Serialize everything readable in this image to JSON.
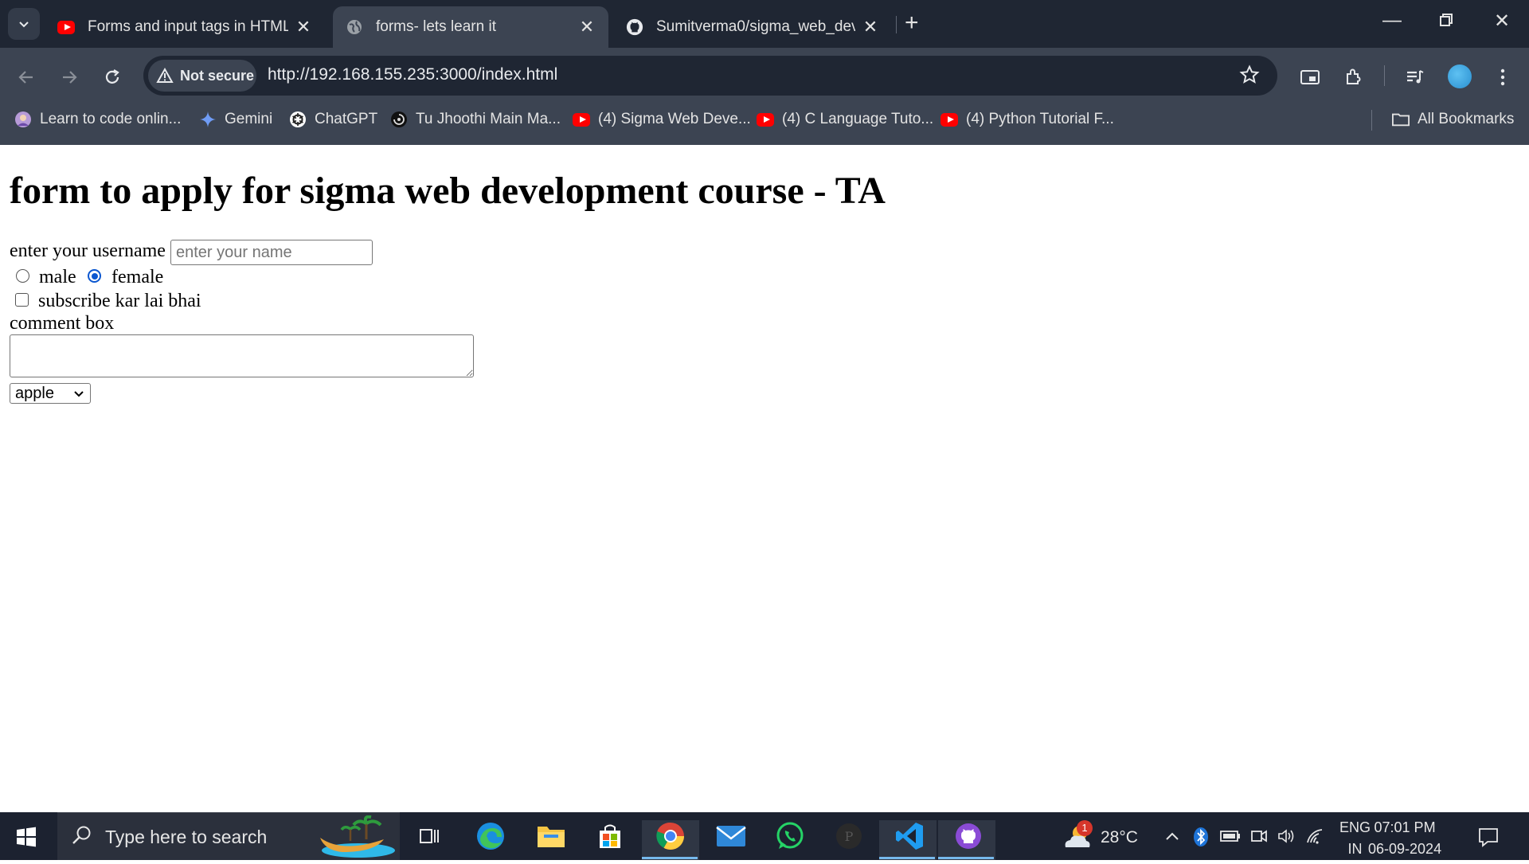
{
  "browser": {
    "tabs": [
      {
        "title": "Forms and input tags in HTML |",
        "active": false,
        "icon": "youtube-icon"
      },
      {
        "title": "forms- lets learn it",
        "active": true,
        "icon": "globe-icon"
      },
      {
        "title": "Sumitverma0/sigma_web_dev: |",
        "active": false,
        "icon": "github-icon"
      }
    ],
    "security_label": "Not secure",
    "url": "http://192.168.155.235:3000/index.html",
    "bookmarks": [
      {
        "label": "Learn to code onlin...",
        "icon": "avatar-icon"
      },
      {
        "label": "Gemini",
        "icon": "gemini-icon"
      },
      {
        "label": "ChatGPT",
        "icon": "chatgpt-icon"
      },
      {
        "label": "Tu Jhoothi Main Ma...",
        "icon": "music-icon"
      },
      {
        "label": "(4) Sigma Web Deve...",
        "icon": "youtube-icon"
      },
      {
        "label": "(4) C Language Tuto...",
        "icon": "youtube-icon"
      },
      {
        "label": "(4) Python Tutorial F...",
        "icon": "youtube-icon"
      }
    ],
    "all_bookmarks_label": "All Bookmarks"
  },
  "page": {
    "heading": "form to apply for sigma web development course - TA",
    "username_label": "enter your username",
    "username_placeholder": "enter your name",
    "gender_options": [
      {
        "label": "male",
        "checked": false
      },
      {
        "label": "female",
        "checked": true
      }
    ],
    "subscribe_label": "subscribe kar lai bhai",
    "subscribe_checked": false,
    "comment_label": "comment box",
    "select_value": "apple"
  },
  "taskbar": {
    "search_placeholder": "Type here to search",
    "weather_temp": "28°C",
    "weather_badge": "1",
    "language_top": "ENG",
    "language_bottom": "IN",
    "time": "07:01 PM",
    "date": "06-09-2024"
  },
  "colors": {
    "tab_strip": "#1f2633",
    "toolbar": "#3c4452",
    "radio_accent": "#0b57d0",
    "taskbar": "#1c2230"
  }
}
